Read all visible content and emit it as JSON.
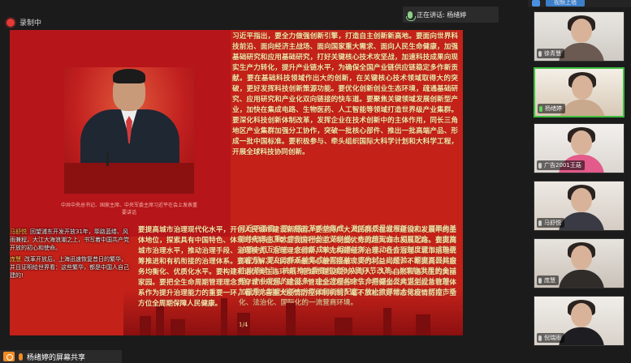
{
  "recording": {
    "label": "录制中"
  },
  "speaking": {
    "label": "正在讲话: 杨绪婷"
  },
  "top_bar": {
    "label": "视频上墙"
  },
  "slide": {
    "caption": "中共中央总书记、国家主席、中央军委主席习近平在会上发表重要讲话",
    "right_text": "习近平指出，要全力做强创新引擎，打造自主创新新高地。要面向世界科技前沿、面向经济主战场、面向国家重大需求、面向人民生命健康，加强基础研究和应用基础研究，打好关键核心技术攻坚战，加速科技成果向现实生产力转化，提升产业链水平，为确保全国产业链供应链稳定多作新贡献。要在基础科技领域作出大的创新，在关键核心技术领域取得大的突破，更好发挥科技创新策源功能。要优化创新创业生态环境，疏通基础研究、应用研究和产业化双向链接的快车道。要聚焦关键领域发展创新型产业，加快在集成电路、生物医药、人工智能等领域打造世界级产业集群。要深化科技创新体制改革，发挥企业在技术创新中的主体作用，同长三角地区产业集群加强分工协作，突破一批核心部件、推出一批高端产品、形成一批中国标准。要积极参与、牵头组织国际大科学计划和大科学工程，开展全球科技协同创新。",
    "bottom_text_1": "习近平强调，要加强改革系统集成，激活高质量发展新动力。要聚焦基础性和具有重大牵引作用的改革举措，在政策取向上相互配合、在实施过程中相互促进、在改革成效上相得益彰，推动各方面制度更加成熟更加定型。要在改革系统集成协同高效上率先试、出经验，探索开展综合性改革试点，统筹推进重要领域和关键环节改革，从事物发展的全过程、产业发展的全链条、企业发展的全生命周期出发来谋划设计改革，加强重大制度创新充分联动和衔接配套，放大改革综合效应，打造市场化、法治化、国际化的一流营商环境。",
    "bottom_text_2": "要提高城市治理现代化水平，开创人民城市建设新局面。要坚持广大人民群众在城市建设和发展中的主体地位，探索具有中国特色、体现时代特征、彰显我国社会主义制度优势的超大城市发展之路。要提高城市治理水平，推动治理手段、治理模式、治理理念创新，率先构建经济治理、社会治理、城市治理统筹推进和有机衔接的治理体系。要着力解决人民群众最关心最直接最现实的利益问题，不断提高公共服务均衡化、优质化水平。要构建和谐优美生态环境，把城市建设成为人与人、人与自然和谐共生的美丽家园。要把全生命周期管理理念贯穿城市规划、建设、管理全过程各环节，把健全公共卫生应急管理体系作为提升治理能力的重要一环，着力完善重大疫情防控体制机制，毫不放松抓好常态化疫情防控，全方位全周期保障人民健康。",
    "page": "1/4"
  },
  "chat": [
    {
      "name": "马舒悦",
      "text": "回望浦东开发开放31年，筚路蓝缕、风雨兼程，大江大海浪潮之上，书写着中国共产党开放的初心和使命。"
    },
    {
      "name": "庞慧",
      "text": "改革开放后，上海迅速恢复昔日的繁华，并且证明给世界看：这些繁华，都是中国人自己建的!"
    }
  ],
  "share_bar": {
    "label": "杨绪婷的屏幕共享"
  },
  "participants": [
    {
      "name": "徐青慧",
      "mic": "off"
    },
    {
      "name": "杨绪婷",
      "mic": "on"
    },
    {
      "name": "广告2001王菇",
      "mic": "off"
    },
    {
      "name": "马舒悦",
      "mic": "off"
    },
    {
      "name": "庞慧",
      "mic": "off"
    },
    {
      "name": "倪瑞雨",
      "mic": "off"
    }
  ],
  "colors": {
    "slide_red": "#c42119",
    "slide_text": "#f7e6a8",
    "chat_name": "#f6c84b",
    "active_border": "#3fbf3f",
    "accent_orange": "#f28b24"
  }
}
